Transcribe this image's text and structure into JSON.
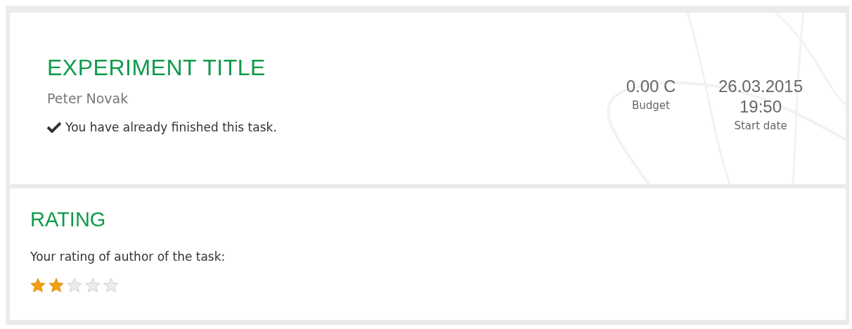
{
  "header": {
    "title": "EXPERIMENT TITLE",
    "author": "Peter Novak",
    "status": "You have already finished this task.",
    "finished": true,
    "stats": [
      {
        "value": "0.00 C",
        "label": "Budget"
      },
      {
        "value": "26.03.2015 19:50",
        "label": "Start date"
      }
    ]
  },
  "rating": {
    "title": "RATING",
    "prompt": "Your rating of author of the task:",
    "stars": 2
  }
}
